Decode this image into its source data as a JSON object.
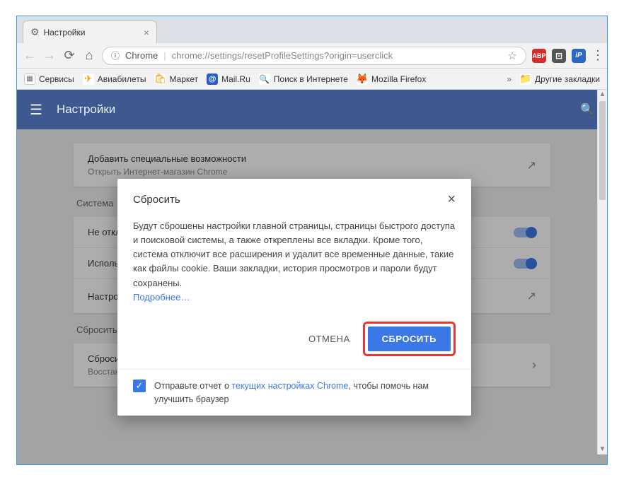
{
  "window": {
    "tab_title": "Настройки",
    "address_label": "Chrome",
    "url": "chrome://settings/resetProfileSettings?origin=userclick",
    "bookmarks": [
      {
        "label": "Сервисы",
        "icon": "apps"
      },
      {
        "label": "Авиабилеты",
        "icon": "avia"
      },
      {
        "label": "Маркет",
        "icon": "market"
      },
      {
        "label": "Mail.Ru",
        "icon": "mail"
      },
      {
        "label": "Поиск в Интернете",
        "icon": "search"
      },
      {
        "label": "Mozilla Firefox",
        "icon": "ff"
      }
    ],
    "other_bookmarks": "Другие закладки",
    "overflow": "»"
  },
  "settings": {
    "header_title": "Настройки",
    "cards": {
      "a11y": {
        "title": "Добавить специальные возможности",
        "sub": "Открыть Интернет-магазин Chrome"
      },
      "system_label": "Система",
      "sys_row1": "Не отключать...",
      "sys_row2": "Использовать...",
      "sys_row3": "Настройки...",
      "reset_label": "Сбросить",
      "reset_title": "Сбросить",
      "reset_sub": "Восстановление настроек по умолчанию"
    }
  },
  "dialog": {
    "title": "Сбросить",
    "body": "Будут сброшены настройки главной страницы, страницы быстрого доступа и поисковой системы, а также откреплены все вкладки. Кроме того, система отключит все расширения и удалит все временные данные, такие как файлы cookie. Ваши закладки, история просмотров и пароли будут сохранены.",
    "more": "Подробнее…",
    "cancel": "ОТМЕНА",
    "confirm": "СБРОСИТЬ",
    "report_pre": "Отправьте отчет о ",
    "report_link": "текущих настройках Chrome",
    "report_post": ", чтобы помочь нам улучшить браузер"
  }
}
